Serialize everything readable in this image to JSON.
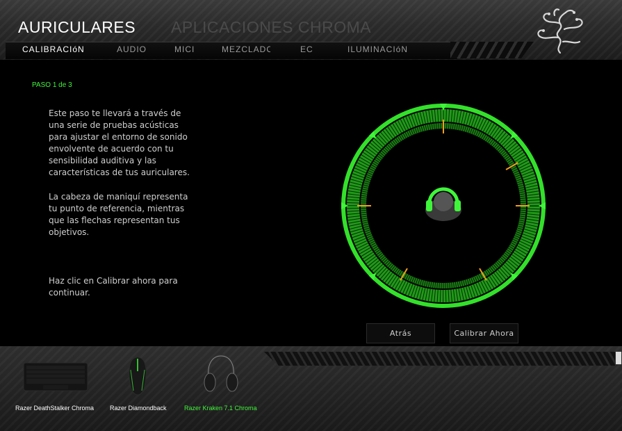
{
  "header": {
    "title": "AURICULARES",
    "secondary_title": "APLICACIONES CHROMA",
    "logo_icon": "razer-snake-logo"
  },
  "tabs": [
    {
      "label": "CALIBRACIóN",
      "active": true
    },
    {
      "label": "AUDIO",
      "active": false
    },
    {
      "label": "MICI",
      "active": false
    },
    {
      "label": "MEZCLADOF",
      "active": false
    },
    {
      "label": "EC",
      "active": false
    },
    {
      "label": "ILUMINACIóN",
      "active": false
    }
  ],
  "content": {
    "step": "PASO 1 de 3",
    "paragraph1": "Este paso te llevará a través de una serie de pruebas acústicas para ajustar el entorno de sonido envolvente de acuerdo con tu sensibilidad auditiva y las características de tus auriculares.",
    "paragraph2": "La cabeza de maniquí representa tu punto de referencia, mientras que las flechas representan tus objetivos.",
    "paragraph3": "Haz clic en Calibrar ahora para continuar."
  },
  "buttons": {
    "back": "Atrás",
    "calibrate": "Calibrar Ahora"
  },
  "devices": [
    {
      "name": "Razer DeathStalker Chroma",
      "icon": "keyboard-icon",
      "active": false
    },
    {
      "name": "Razer Diamondback",
      "icon": "mouse-icon",
      "active": false
    },
    {
      "name": "Razer Kraken 7.1 Chroma",
      "icon": "headset-icon",
      "active": true
    }
  ],
  "colors": {
    "accent": "#3ff53a",
    "marker": "#f0a020",
    "background": "#000000"
  }
}
